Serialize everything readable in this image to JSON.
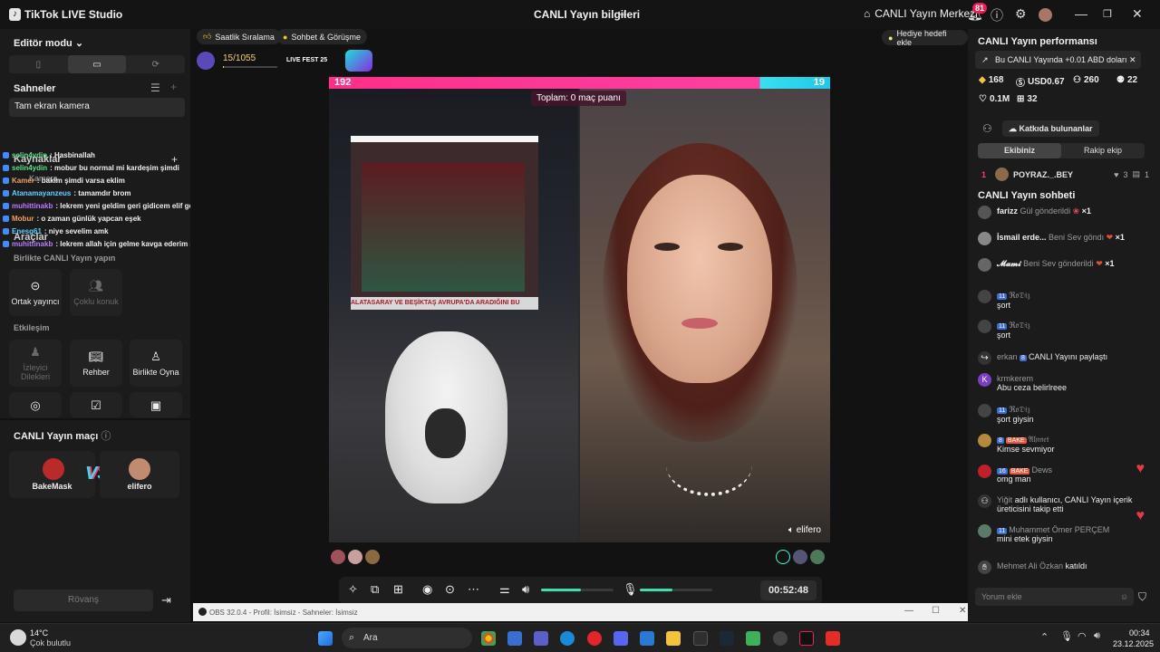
{
  "titlebar": {
    "app_name": "TikTok LIVE Studio",
    "center_title": "CANLI Yayın bilgileri",
    "live_center": "CANLI Yayın Merkezi",
    "notif_count": "81"
  },
  "left": {
    "editor_mode": "Editör modu",
    "scenes_title": "Sahneler",
    "scene_item": "Tam ekran kamera",
    "sources_title": "Kaynaklar",
    "camera_label": "Kamera",
    "tools_title": "Araçlar",
    "together_title": "Birlikte CANLI Yayın yapın",
    "co_host": "Ortak yayıncı",
    "multi_guest": "Çoklu konuk",
    "interaction_title": "Etkileşim",
    "viewer_requests": "İzleyici Dilekleri",
    "guide": "Rehber",
    "play_together": "Birlikte Oyna",
    "match_title": "CANLI Yayın maçı",
    "player1": "BakeMask",
    "player2": "elifero",
    "rematch": "Rövanş",
    "chat": [
      {
        "name": "selin4ydin",
        "text": ": Hasbinallah"
      },
      {
        "name": "selin4ydin",
        "text": ": mobur bu normal mi kardeşim şimdi"
      },
      {
        "name": "Kamer",
        "text": ": bakim şimdi varsa eklim"
      },
      {
        "name": "Atanamayanzeus",
        "text": ": tamamdır brom"
      },
      {
        "name": "muhittinakb",
        "text": ": lekrem yeni geldim geri gidicem elif gelmiş"
      },
      {
        "name": "Mobur",
        "text": ": o zaman günlük yapcan eşek"
      },
      {
        "name": "Enesg61",
        "text": ": niye sevelim amk"
      },
      {
        "name": "muhittinakb",
        "text": ": lekrem allah için gelme kavga ederim senke"
      }
    ]
  },
  "center": {
    "hourly_ranking": "Saatlik Sıralama",
    "chat_meet": "Sohbet & Görüşme",
    "gift_goal": "Hediye hedefi ekle",
    "progress": "15/1055",
    "fest_label": "LIVE FEST 25",
    "score_left": "192",
    "score_right": "19",
    "total_points": "Toplam: 0 maç puanı",
    "tv_caption": "ALATASARAY VE BEŞİKTAŞ AVRUPA'DA ARADIĞINI BU",
    "stage_name": "elifero",
    "timer": "00:52:48",
    "mic_level": 0.45,
    "volume_level": 0.55
  },
  "obs": {
    "title": "OBS 32.0.4 - Profil: İsimsiz - Sahneler: İsimsiz"
  },
  "right": {
    "perf_title": "CANLI Yayın performansı",
    "earnings": "Bu CANLI Yayında +0.01 ABD doları",
    "stat1": "168",
    "stat2": "USD0.67",
    "stat3": "260",
    "stat4": "22",
    "stat5": "0.1M",
    "stat6": "32",
    "contributors": "Katkıda bulunanlar",
    "team_mine": "Ekibiniz",
    "team_rival": "Rakip ekip",
    "rank_no": "1",
    "rank_name": "POYRAZ._.BEY",
    "rank_score": "3",
    "rank_count": "1",
    "chat_title": "CANLI Yayın sohbeti",
    "comment_placeholder": "Yorum ekle",
    "messages": [
      {
        "name": "farizz",
        "text": "Gül gönderildi",
        "extra": "×1"
      },
      {
        "name": "İsmail erde...",
        "text": "Beni Sev göndı",
        "extra": "×1"
      },
      {
        "name": "𝓜𝓪𝓶𝓲",
        "text": "Beni Sev gönderildi",
        "extra": "×1"
      },
      {
        "level": "11",
        "name": "ℜ𝔬𝔇𝔦𝔷",
        "text": "şort"
      },
      {
        "level": "11",
        "name": "ℜ𝔬𝔇𝔦𝔷",
        "text": "şort"
      },
      {
        "name": "erkan",
        "level": "8",
        "text": "CANLI Yayını paylaştı"
      },
      {
        "name": "krmkerem",
        "text": "Abu ceza belirlreee"
      },
      {
        "level": "11",
        "name": "ℜ𝔬𝔇𝔦𝔷",
        "text": "şort giysin"
      },
      {
        "level": "8",
        "tag": "BAKE",
        "name": "𝔄𝔥𝔪𝔢𝔱",
        "text": "Kimse sevmiyor"
      },
      {
        "level": "16",
        "tag": "BAKE",
        "name": "Dews",
        "text": "omg man"
      },
      {
        "name": "Yiğit",
        "text": "adlı kullanıcı, CANLI Yayın içerik üreticisini takip etti"
      },
      {
        "level": "11",
        "name": "Muhammet Ömer PERÇEM",
        "text": "mini etek giysin"
      },
      {
        "name": "Mehmet Ali Özkan",
        "text": "katıldı"
      }
    ]
  },
  "taskbar": {
    "temp": "14°C",
    "weather": "Çok bulutlu",
    "search": "Ara",
    "time": "00:34",
    "date": "23.12.2025"
  }
}
